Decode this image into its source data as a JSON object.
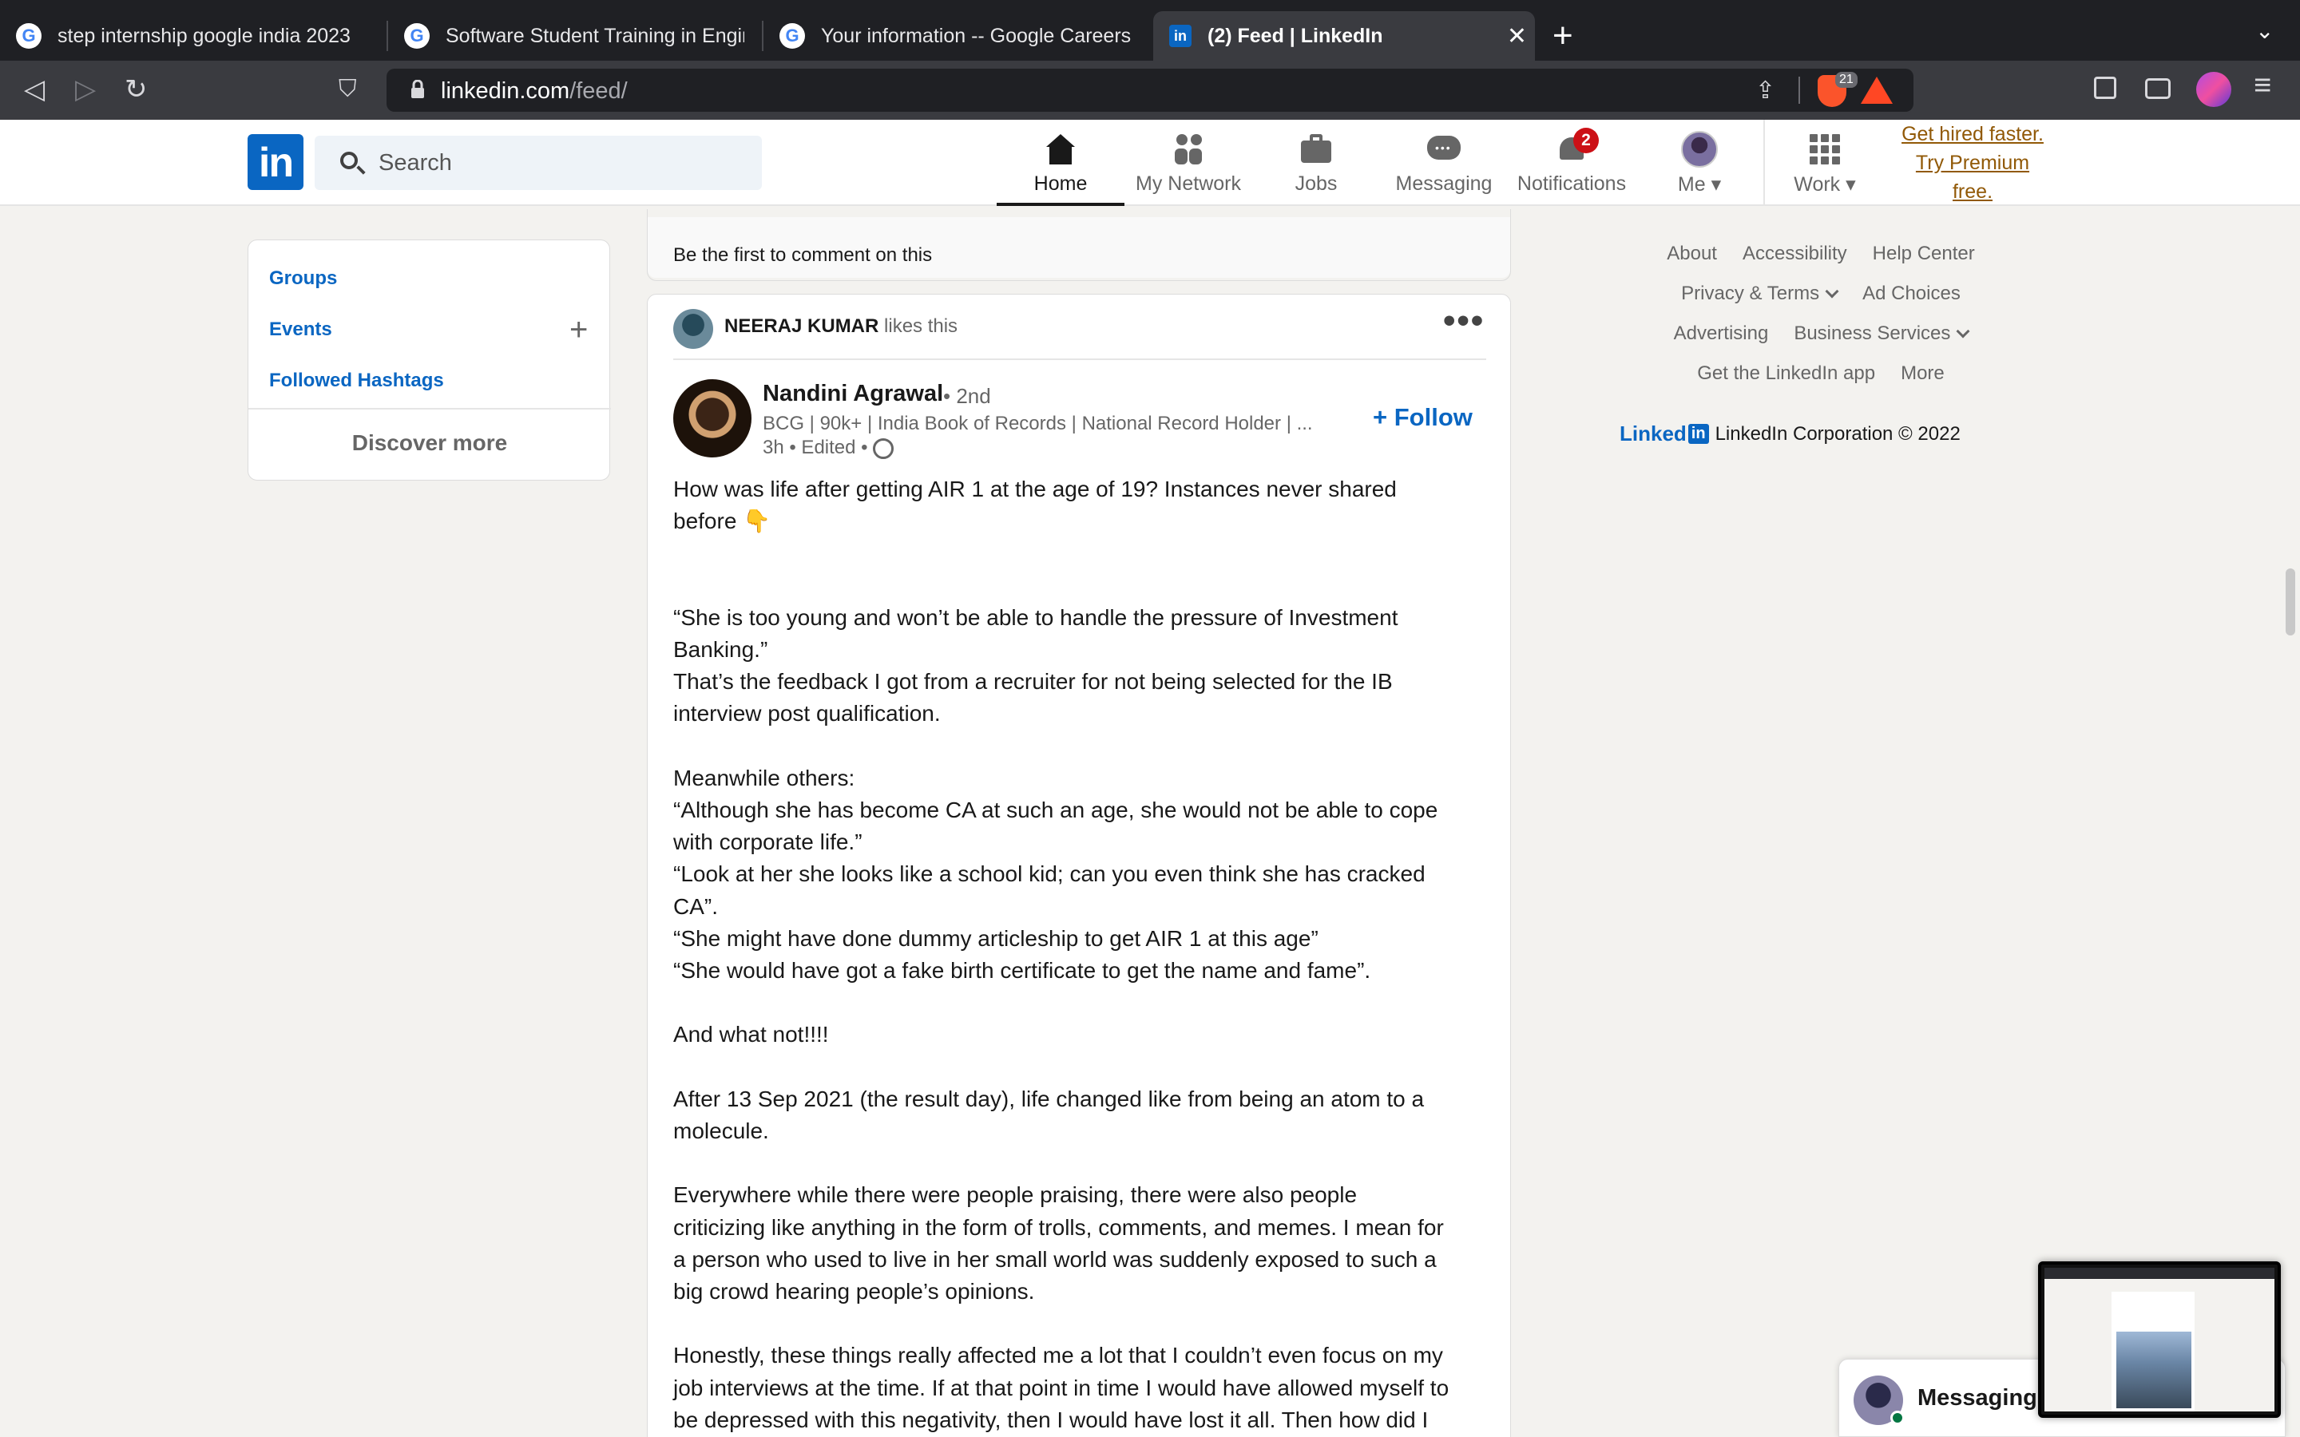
{
  "browser": {
    "tabs": [
      {
        "title": "step internship google india 2023",
        "icon": "google-icon",
        "active": false
      },
      {
        "title": "Software Student Training in Engine",
        "icon": "google-icon",
        "active": false
      },
      {
        "title": "Your information -- Google Careers",
        "icon": "google-icon",
        "active": false
      },
      {
        "title": "(2) Feed | LinkedIn",
        "icon": "linkedin-icon",
        "active": true
      }
    ],
    "url_domain": "linkedin.com",
    "url_path": "/feed/",
    "brave_shield_count": "21",
    "new_tab_symbol": "+",
    "close_symbol": "✕"
  },
  "linkedin": {
    "logo_text": "in",
    "search_placeholder": "Search",
    "nav": {
      "home": "Home",
      "network": "My Network",
      "jobs": "Jobs",
      "messaging": "Messaging",
      "notifications": "Notifications",
      "notifications_badge": "2",
      "me": "Me",
      "work": "Work"
    },
    "premium": {
      "line1": "Get hired faster.",
      "line2": "Try Premium",
      "line3": "free."
    }
  },
  "sidebar": {
    "groups": "Groups",
    "events": "Events",
    "followed_hashtags": "Followed Hashtags",
    "discover_more": "Discover more"
  },
  "feed": {
    "prev_post_comment_prompt": "Be the first to comment on this",
    "post": {
      "liker_name": "NEERAJ KUMAR",
      "liker_action": " likes this",
      "author_name": "Nandini Agrawal",
      "author_degree": "• 2nd",
      "author_headline": "BCG | 90k+ | India Book of Records | National Record Holder | ...",
      "meta": "3h • Edited •",
      "follow_label": "+ Follow",
      "body": "How was life after getting AIR 1 at the age of 19? Instances never shared\nbefore 👇\n\n\n“She is too young and won’t be able to handle the pressure of Investment\nBanking.”\nThat’s the feedback I got from a recruiter for not being selected for the IB\ninterview post qualification.\n\nMeanwhile others:\n“Although she has become CA at such an age, she would not be able to cope\nwith corporate life.”\n“Look at her she looks like a school kid; can you even think she has cracked\nCA”.\n“She might have done dummy articleship to get AIR 1 at this age”\n“She would have got a fake birth certificate to get the name and fame”.\n\nAnd what not!!!!\n\nAfter 13 Sep 2021 (the result day), life changed like from being an atom to a\nmolecule.\n\nEverywhere while there were people praising, there were also people\ncriticizing like anything in the form of trolls, comments, and memes. I mean for\na person who used to live in her small world was suddenly exposed to such a\nbig crowd hearing people’s opinions.\n\nHonestly, these things really affected me a lot that I couldn’t even focus on my\njob interviews at the time. If at that point in time I would have allowed myself to\nbe depressed with this negativity, then I would have lost it all. Then how did I"
    }
  },
  "footer": {
    "about": "About",
    "accessibility": "Accessibility",
    "help_center": "Help Center",
    "privacy_terms": "Privacy & Terms",
    "ad_choices": "Ad Choices",
    "advertising": "Advertising",
    "business_services": "Business Services",
    "get_app": "Get the LinkedIn app",
    "more": "More",
    "brand_word": "Linked",
    "brand_in": "in",
    "copyright": "LinkedIn Corporation © 2022"
  },
  "messaging_bar": {
    "label": "Messaging"
  },
  "colors": {
    "linkedin_blue": "#0a66c2",
    "premium_gold": "#915907",
    "badge_red": "#cc1016"
  }
}
